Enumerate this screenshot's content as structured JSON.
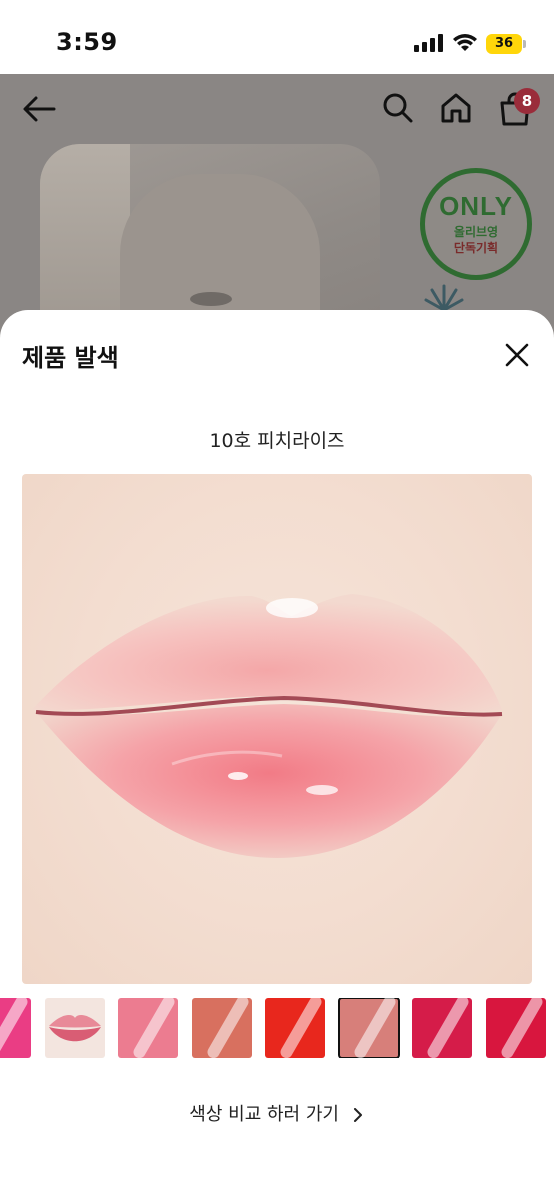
{
  "status_bar": {
    "time": "3:59",
    "battery": "36",
    "battery_color": "#ffd60a"
  },
  "background_app": {
    "nav": {
      "back_icon": "arrow-left-icon",
      "search_icon": "search-icon",
      "home_icon": "home-icon",
      "cart_icon": "shopping-bag-icon",
      "cart_count": "8"
    },
    "badge": {
      "title": "ONLY",
      "line1": "올리브영",
      "line2": "단독기획"
    }
  },
  "sheet": {
    "title": "제품 발색",
    "close_icon": "close-icon",
    "shade_name": "10호 피치라이즈",
    "swatches": [
      {
        "color": "#ea3d84",
        "selected": false
      },
      {
        "color": "#f4c9cc",
        "selected": false
      },
      {
        "color": "#ec7c90",
        "selected": false
      },
      {
        "color": "#d8705f",
        "selected": false
      },
      {
        "color": "#e8271d",
        "selected": false
      },
      {
        "color": "#d77f7a",
        "selected": true
      },
      {
        "color": "#d51c49",
        "selected": false
      },
      {
        "color": "#d8163e",
        "selected": false
      }
    ],
    "compare_label": "색상 비교 하러 가기",
    "compare_icon": "chevron-right-icon"
  }
}
